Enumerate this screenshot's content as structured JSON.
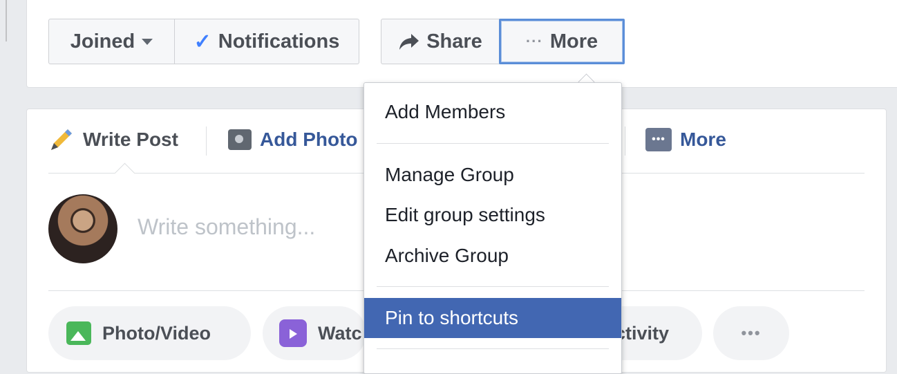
{
  "group_actions": {
    "joined_label": "Joined",
    "notifications_label": "Notifications",
    "share_label": "Share",
    "more_label": "More"
  },
  "composer": {
    "tabs": {
      "write_post": "Write Post",
      "add_photo": "Add Photo",
      "more": "More"
    },
    "placeholder": "Write something...",
    "quick_actions": {
      "photo_video": "Photo/Video",
      "watch": "Watc",
      "activity": "ctivity",
      "more_dots": "•••"
    }
  },
  "more_menu": {
    "items": [
      {
        "label": "Add Members"
      },
      {
        "label": "Manage Group"
      },
      {
        "label": "Edit group settings"
      },
      {
        "label": "Archive Group"
      },
      {
        "label": "Pin to shortcuts",
        "highlighted": true
      }
    ]
  },
  "colors": {
    "accent_blue": "#4267b2",
    "link_blue": "#365899",
    "focus_ring": "#5b8ed8",
    "check_blue": "#4080ff",
    "page_bg": "#e9ebee"
  },
  "icons": [
    "caret-down-icon",
    "check-icon",
    "share-arrow-icon",
    "more-dots-icon",
    "pencil-icon",
    "camera-icon",
    "photo-icon",
    "watch-icon"
  ]
}
